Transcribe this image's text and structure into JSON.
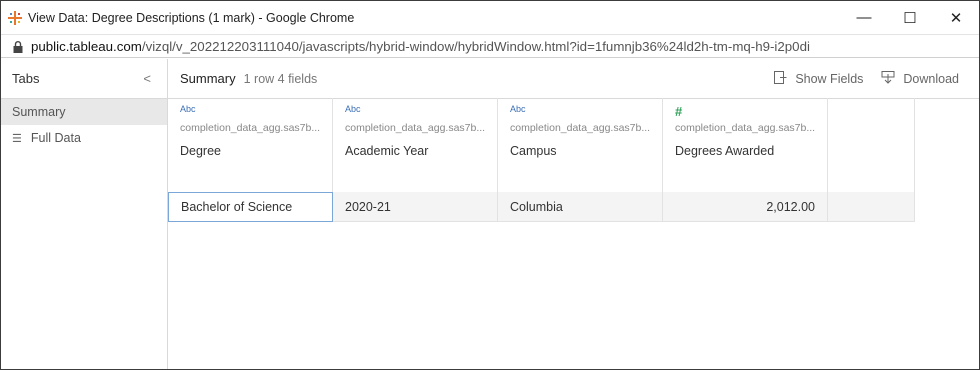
{
  "window": {
    "title": "View Data: Degree Descriptions (1 mark) - Google Chrome",
    "minimize": "—",
    "maximize": "☐",
    "close": "✕"
  },
  "address": {
    "host": "public.tableau.com",
    "path": "/vizql/v_202212203111040/javascripts/hybrid-window/hybridWindow.html?id=1fumnjb36%24ld2h-tm-mq-h9-i2p0di"
  },
  "sidebar": {
    "heading": "Tabs",
    "collapse": "<",
    "items": [
      {
        "label": "Summary"
      },
      {
        "label": "Full Data",
        "icon": "☰"
      }
    ]
  },
  "toolbar": {
    "title": "Summary",
    "count": "1 row  4 fields",
    "show_fields": "Show Fields",
    "download": "Download"
  },
  "columns": [
    {
      "type": "Abc",
      "source": "completion_data_agg.sas7b...",
      "name": "Degree"
    },
    {
      "type": "Abc",
      "source": "completion_data_agg.sas7b...",
      "name": "Academic Year"
    },
    {
      "type": "Abc",
      "source": "completion_data_agg.sas7b...",
      "name": "Campus"
    },
    {
      "type": "#",
      "source": "completion_data_agg.sas7b...",
      "name": "Degrees Awarded"
    }
  ],
  "rows": [
    [
      "Bachelor of Science",
      "2020-21",
      "Columbia",
      "2,012.00"
    ]
  ],
  "colors": {
    "string_type": "#3b6fb6",
    "number_type": "#2fa35a",
    "selection_border": "#7aa7d8"
  }
}
